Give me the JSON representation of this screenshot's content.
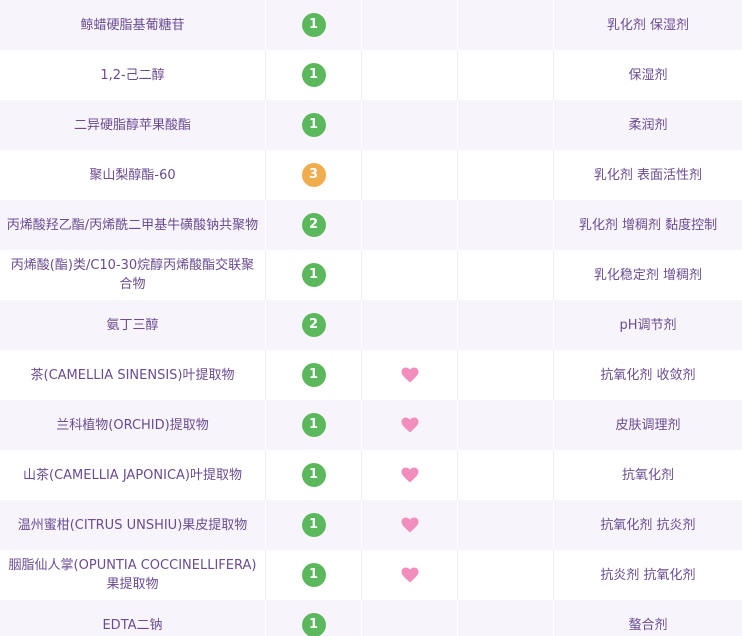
{
  "colors": {
    "text": "#6a4c93",
    "row_alt": "#f8f4fc",
    "safe_green": "#5cb85c",
    "warn_orange": "#f0ad4e",
    "heart_pink": "#f18ebd"
  },
  "icons": {
    "active": "heart-icon"
  },
  "rows": [
    {
      "name": "鲸蜡硬脂基葡糖苷",
      "safety": "1",
      "level": "green",
      "active": false,
      "function": "乳化剂 保湿剂"
    },
    {
      "name": "1,2-己二醇",
      "safety": "1",
      "level": "green",
      "active": false,
      "function": "保湿剂"
    },
    {
      "name": "二异硬脂醇苹果酸酯",
      "safety": "1",
      "level": "green",
      "active": false,
      "function": "柔润剂"
    },
    {
      "name": "聚山梨醇酯-60",
      "safety": "3",
      "level": "orange",
      "active": false,
      "function": "乳化剂 表面活性剂"
    },
    {
      "name": "丙烯酸羟乙酯/丙烯酰二甲基牛磺酸钠共聚物",
      "safety": "2",
      "level": "green",
      "active": false,
      "function": "乳化剂 增稠剂 黏度控制"
    },
    {
      "name": "丙烯酸(酯)类/C10-30烷醇丙烯酸酯交联聚合物",
      "safety": "1",
      "level": "green",
      "active": false,
      "function": "乳化稳定剂 增稠剂"
    },
    {
      "name": "氨丁三醇",
      "safety": "2",
      "level": "green",
      "active": false,
      "function": "pH调节剂"
    },
    {
      "name": "茶(CAMELLIA SINENSIS)叶提取物",
      "safety": "1",
      "level": "green",
      "active": true,
      "function": "抗氧化剂 收敛剂"
    },
    {
      "name": "兰科植物(ORCHID)提取物",
      "safety": "1",
      "level": "green",
      "active": true,
      "function": "皮肤调理剂"
    },
    {
      "name": "山茶(CAMELLIA JAPONICA)叶提取物",
      "safety": "1",
      "level": "green",
      "active": true,
      "function": "抗氧化剂"
    },
    {
      "name": "温州蜜柑(CITRUS UNSHIU)果皮提取物",
      "safety": "1",
      "level": "green",
      "active": true,
      "function": "抗氧化剂 抗炎剂"
    },
    {
      "name": "胭脂仙人掌(OPUNTIA COCCINELLIFERA)果提取物",
      "safety": "1",
      "level": "green",
      "active": true,
      "function": "抗炎剂 抗氧化剂"
    },
    {
      "name": "EDTA二钠",
      "safety": "1",
      "level": "green",
      "active": false,
      "function": "螯合剂"
    }
  ]
}
